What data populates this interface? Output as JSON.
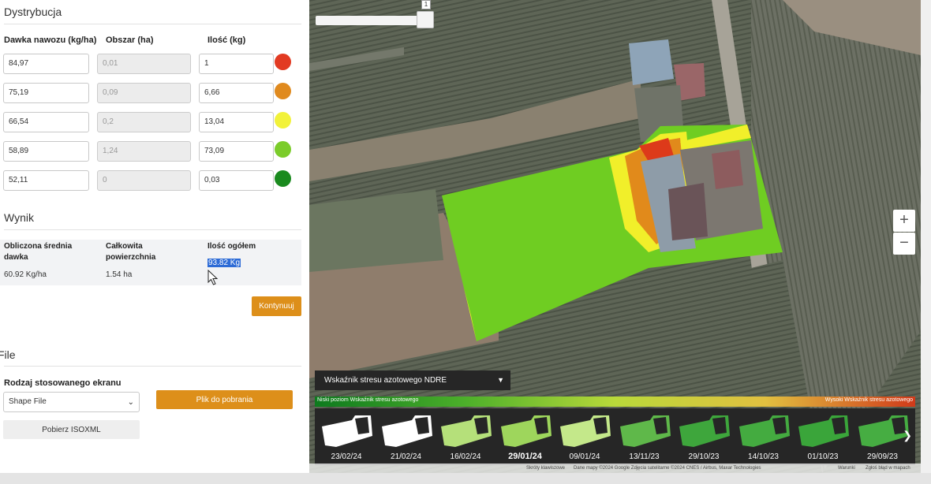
{
  "distribution": {
    "title": "Dystrybucja",
    "col_dose": "Dawka nawozu (kg/ha)",
    "col_area": "Obszar (ha)",
    "col_qty": "Ilość (kg)",
    "rows": [
      {
        "dose": "84,97",
        "area": "0,01",
        "qty": "1",
        "color": "#e23a22"
      },
      {
        "dose": "75,19",
        "area": "0,09",
        "qty": "6,66",
        "color": "#e08a1e"
      },
      {
        "dose": "66,54",
        "area": "0,2",
        "qty": "13,04",
        "color": "#f2f23a"
      },
      {
        "dose": "58,89",
        "area": "1,24",
        "qty": "73,09",
        "color": "#7bcc2a"
      },
      {
        "dose": "52,11",
        "area": "0",
        "qty": "0,03",
        "color": "#1a8a1e"
      }
    ]
  },
  "result": {
    "title": "Wynik",
    "avg_label_1": "Obliczona średnia",
    "avg_label_2": "dawka",
    "avg_value": "60.92 Kg/ha",
    "area_label_1": "Całkowita",
    "area_label_2": "powierzchnia",
    "area_value": "1.54 ha",
    "total_label": "Ilość ogółem",
    "total_value": "93.82 Kg",
    "continue_label": "Kontynuuj"
  },
  "file": {
    "title": "File",
    "screen_type_label": "Rodzaj stosowanego ekranu",
    "screen_type_value": "Shape File",
    "download_label": "Plik do pobrania",
    "isoxml_label": "Pobierz ISOXML"
  },
  "map": {
    "slider_value": "1",
    "zoom_in": "+",
    "zoom_out": "−",
    "layer_select": "Wskaźnik stresu azotowego NDRE",
    "legend_low": "Niski poziom Wskaźnik stresu azotowego",
    "legend_high": "Wysoki Wskaźnik stresu azotowego",
    "dates": [
      "23/02/24",
      "21/02/24",
      "16/02/24",
      "29/01/24",
      "09/01/24",
      "13/11/23",
      "29/10/23",
      "14/10/23",
      "01/10/23",
      "29/09/23"
    ],
    "selected_date": "29/01/24",
    "thumb_colors": [
      "#ffffff",
      "#ffffff",
      "#b5e07a",
      "#9ed65c",
      "#c4e88a",
      "#5fb84a",
      "#3ea63c",
      "#44ab40",
      "#3aa53a",
      "#46ad42"
    ],
    "attribution_1": "Skróty klawiszowe",
    "attribution_2": "Dane mapy ©2024 Google Zdjęcia satelitarne ©2024 CNES / Airbus, Maxar Technologies",
    "attribution_3": "Warunki",
    "attribution_4": "Zgłoś błąd w mapach"
  }
}
